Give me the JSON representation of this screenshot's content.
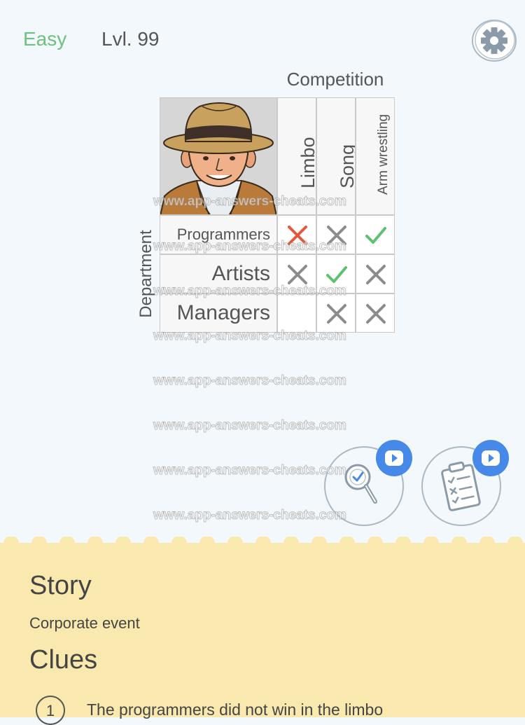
{
  "header": {
    "difficulty": "Easy",
    "level": "Lvl. 99"
  },
  "puzzle": {
    "column_group": "Competition",
    "row_group": "Department",
    "columns": [
      "Limbo",
      "Song",
      "Arm wrestling"
    ],
    "rows": [
      {
        "label": "Programmers",
        "marks": [
          "x-red",
          "x",
          "check"
        ]
      },
      {
        "label": "Artists",
        "marks": [
          "x",
          "check",
          "x"
        ]
      },
      {
        "label": "Managers",
        "marks": [
          "",
          "x",
          "x"
        ]
      }
    ],
    "colors": {
      "cross": "#8c8c8c",
      "wrong_cross": "#e3573a",
      "check": "#5fc070",
      "difficulty": "#6fc17f",
      "video_badge": "#4689e9",
      "panel": "#fae9ae"
    }
  },
  "watermark": "www.app-answers-cheats.com",
  "hints": [
    {
      "icon": "magnifier-check-icon"
    },
    {
      "icon": "clipboard-checklist-icon"
    }
  ],
  "story": {
    "heading": "Story",
    "text": "Corporate event"
  },
  "clues": {
    "heading": "Clues",
    "items": [
      {
        "number": "1",
        "text": "The programmers did not win in the limbo"
      }
    ]
  }
}
